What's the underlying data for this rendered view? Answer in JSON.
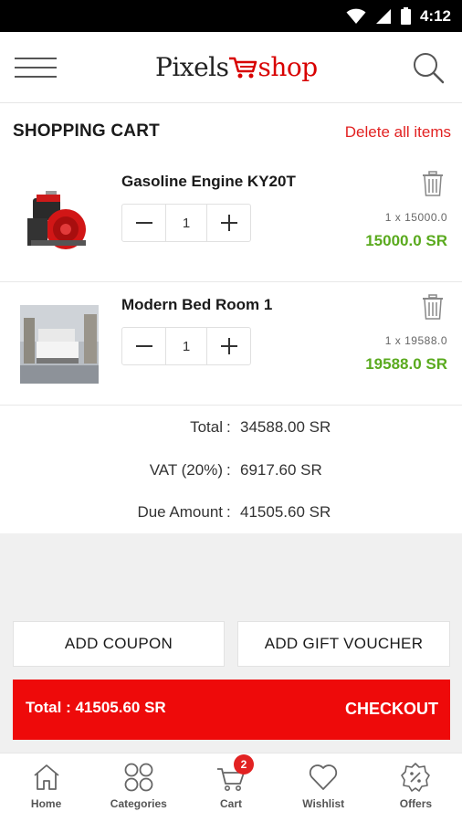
{
  "status_bar": {
    "time": "4:12"
  },
  "header": {
    "logo_part1": "Pixels",
    "logo_part2": "shop"
  },
  "cart": {
    "title": "SHOPPING CART",
    "delete_all_label": "Delete all items",
    "items": [
      {
        "name": "Gasoline Engine KY20T",
        "quantity": "1",
        "unit_line": "1  x  15000.0",
        "price": "15000.0 SR"
      },
      {
        "name": "Modern Bed Room 1",
        "quantity": "1",
        "unit_line": "1  x  19588.0",
        "price": "19588.0 SR"
      }
    ]
  },
  "summary": {
    "colon": ":",
    "total_label": "Total",
    "total_value": "34588.00 SR",
    "vat_label": "VAT (20%)",
    "vat_value": "6917.60 SR",
    "due_label": "Due Amount",
    "due_value": "41505.60 SR"
  },
  "actions": {
    "add_coupon": "ADD COUPON",
    "add_gift_voucher": "ADD GIFT VOUCHER",
    "checkout_total": "Total : 41505.60 SR",
    "checkout": "CHECKOUT"
  },
  "bottom_nav": {
    "cart_badge": "2",
    "items": [
      {
        "label": "Home",
        "icon": "home-icon"
      },
      {
        "label": "Categories",
        "icon": "categories-icon"
      },
      {
        "label": "Cart",
        "icon": "cart-icon"
      },
      {
        "label": "Wishlist",
        "icon": "heart-icon"
      },
      {
        "label": "Offers",
        "icon": "offers-badge-icon"
      }
    ]
  },
  "colors": {
    "brand_red": "#ee0a0a",
    "price_green": "#5aaa1e",
    "link_red": "#e22222"
  }
}
